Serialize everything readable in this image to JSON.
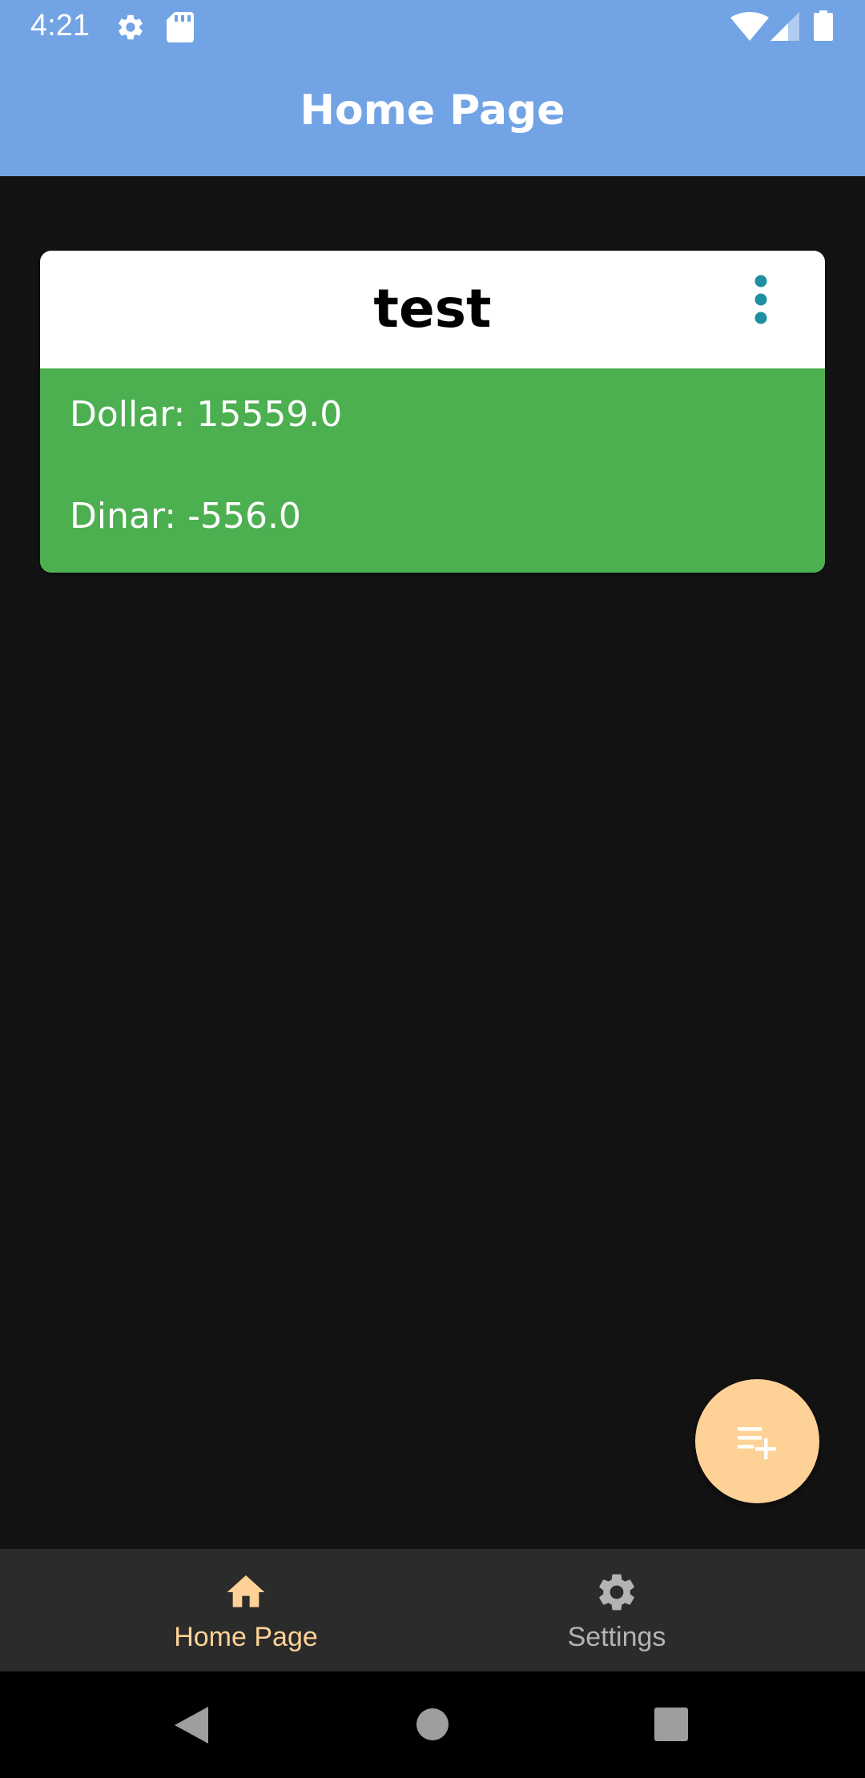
{
  "status_bar": {
    "time": "4:21",
    "icons": [
      "gear-icon",
      "sd-card-icon",
      "wifi-icon",
      "signal-icon",
      "battery-icon"
    ]
  },
  "app_bar": {
    "title": "Home Page",
    "color": "#71A3E5"
  },
  "card": {
    "title": "test",
    "menu_icon": "more-vert-icon",
    "dollar_label": "Dollar: 15559.0",
    "dinar_label": "Dinar: -556.0",
    "body_color": "#4CAF50"
  },
  "fab": {
    "icon": "playlist-add-icon",
    "color": "#FED297"
  },
  "bottom_nav": {
    "items": [
      {
        "label": "Home Page",
        "icon": "home-icon",
        "selected": true
      },
      {
        "label": "Settings",
        "icon": "gear-icon",
        "selected": false
      }
    ]
  },
  "system_nav": {
    "buttons": [
      "back-icon",
      "home-circle-icon",
      "recents-icon"
    ]
  }
}
